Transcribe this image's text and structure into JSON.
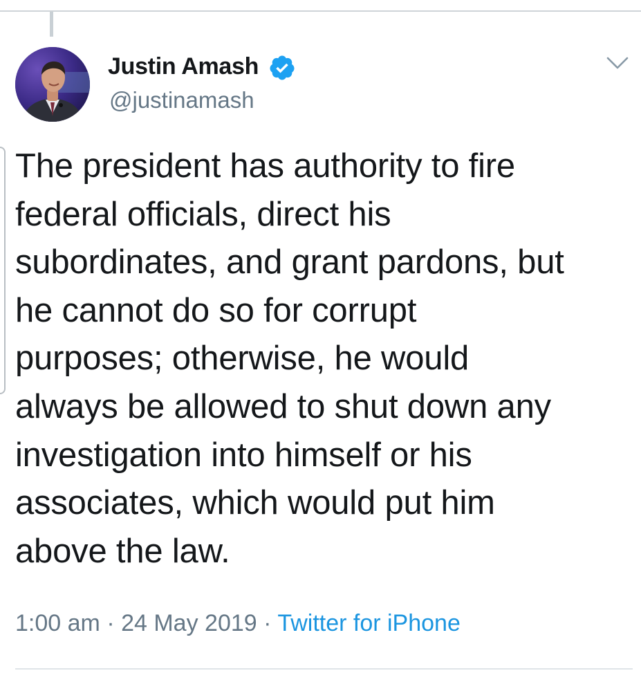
{
  "tweet": {
    "author": {
      "name": "Justin Amash",
      "handle": "@justinamash",
      "verified": true
    },
    "text": "The president has authority to fire\nfederal officials, direct his\nsubordinates, and grant pardons, but\nhe cannot do so for corrupt\npurposes; otherwise, he would\nalways be allowed to shut down any\ninvestigation into himself or his\nassociates, which would put him\nabove the law.",
    "time": "1:00 am",
    "separator": "·",
    "date": "24 May 2019",
    "source": "Twitter for iPhone"
  },
  "icons": {
    "verified": "verified-badge-icon",
    "menu": "chevron-down-icon"
  },
  "colors": {
    "text": "#14171a",
    "secondary": "#657786",
    "link": "#1b95e0",
    "verified": "#1da1f2"
  }
}
